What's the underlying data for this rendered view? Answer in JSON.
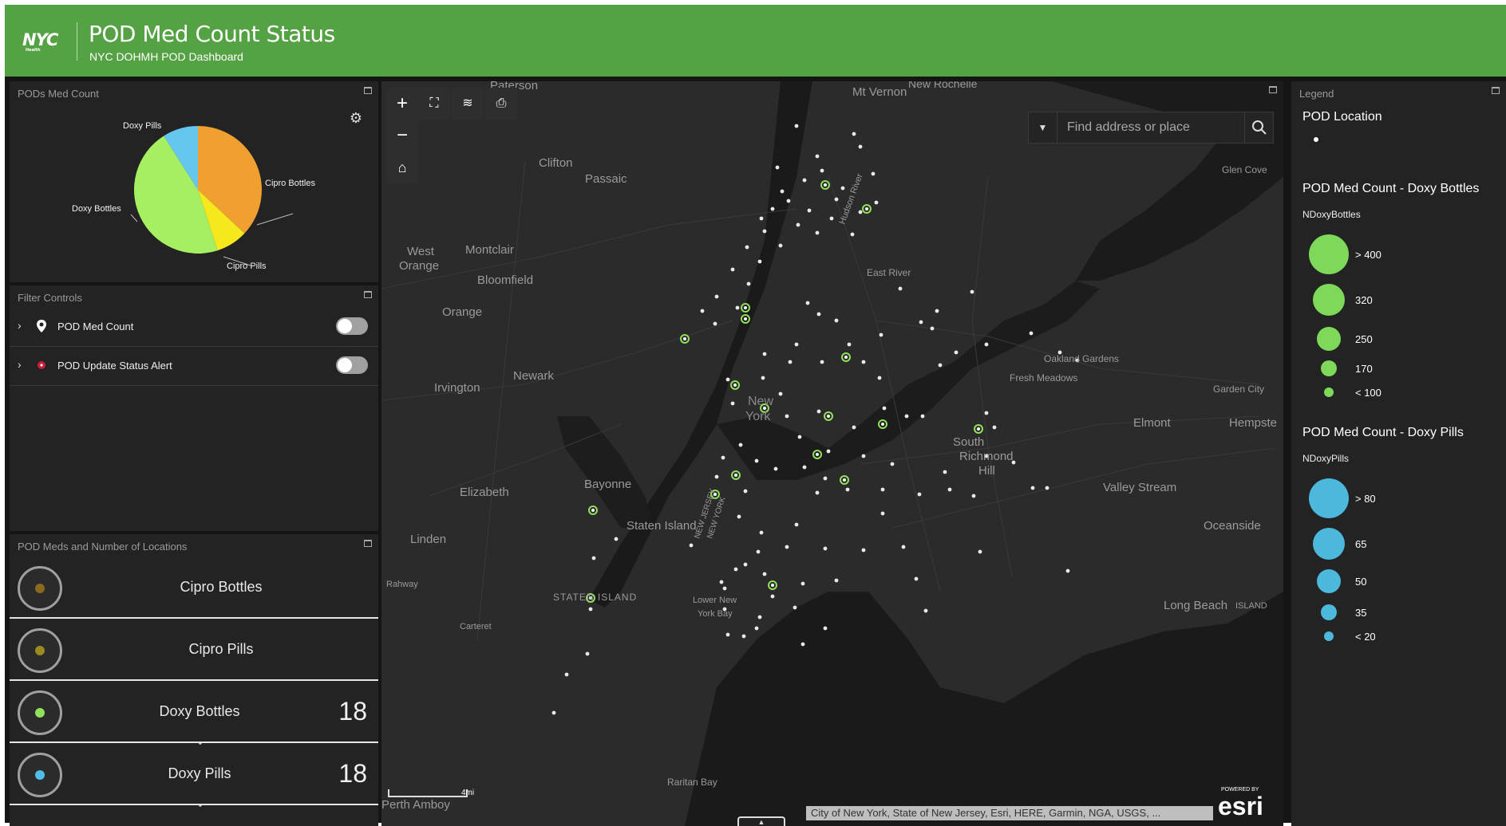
{
  "header": {
    "logo": "NYC",
    "logo_sub": "Health",
    "title": "POD Med Count Status",
    "subtitle": "NYC DOHMH POD Dashboard"
  },
  "pie_panel": {
    "title": "PODs Med Count",
    "chart_data": {
      "type": "pie",
      "categories": [
        "Cipro Bottles",
        "Cipro Pills",
        "Doxy Bottles",
        "Doxy Pills"
      ],
      "values": [
        37,
        8,
        46,
        9
      ],
      "colors": [
        "#f0a030",
        "#f5e81c",
        "#a6ef62",
        "#65c6ee"
      ]
    }
  },
  "filter_panel": {
    "title": "Filter Controls",
    "items": [
      {
        "label": "POD Med Count",
        "enabled": false
      },
      {
        "label": "POD Update Status Alert",
        "enabled": false
      }
    ]
  },
  "meds_panel": {
    "title": "POD Meds and Number of Locations",
    "items": [
      {
        "label": "Cipro Bottles",
        "count": "",
        "dot": "#8a6820"
      },
      {
        "label": "Cipro Pills",
        "count": "",
        "dot": "#9a8a20"
      },
      {
        "label": "Doxy Bottles",
        "count": "18",
        "dot": "#8fe05a"
      },
      {
        "label": "Doxy Pills",
        "count": "18",
        "dot": "#4ebde8"
      }
    ]
  },
  "map": {
    "search_placeholder": "Find address or place",
    "attribution": "City of New York, State of New Jersey, Esri, HERE, Garmin, NGA, USGS, ...",
    "powered_by": "POWERED BY",
    "esri": "esri",
    "scale": "4mi",
    "place_labels": [
      "Paterson",
      "Mt Vernon",
      "New Rochelle",
      "Clifton",
      "Passaic",
      "Glen Cove",
      "West Orange",
      "Montclair",
      "Bloomfield",
      "East River",
      "Orange",
      "Oakland Gardens",
      "Fresh Meadows",
      "Irvington",
      "Newark",
      "New York",
      "Garden City",
      "Elmont",
      "Hempste",
      "South Richmond Hill",
      "Bayonne",
      "Elizabeth",
      "Valley Stream",
      "Linden",
      "Staten Island",
      "Oceanside",
      "Rahway",
      "STATEN ISLAND",
      "Lower New York Bay",
      "Long Beach",
      "ISLAND",
      "Carteret",
      "Raritan Bay",
      "Perth Amboy",
      "Hudson River",
      "NEW JERSEY",
      "NEW YORK"
    ]
  },
  "legend": {
    "title": "Legend",
    "pod_location": "POD Location",
    "doxy_bottles": {
      "title": "POD Med Count - Doxy Bottles",
      "field": "NDoxyBottles",
      "classes": [
        "> 400",
        "320",
        "250",
        "170",
        "< 100"
      ]
    },
    "doxy_pills": {
      "title": "POD Med Count - Doxy Pills",
      "field": "NDoxyPills",
      "classes": [
        "> 80",
        "65",
        "50",
        "35",
        "< 20"
      ]
    },
    "colors": {
      "green": "#7ed85a",
      "blue": "#4bb8dc"
    }
  }
}
